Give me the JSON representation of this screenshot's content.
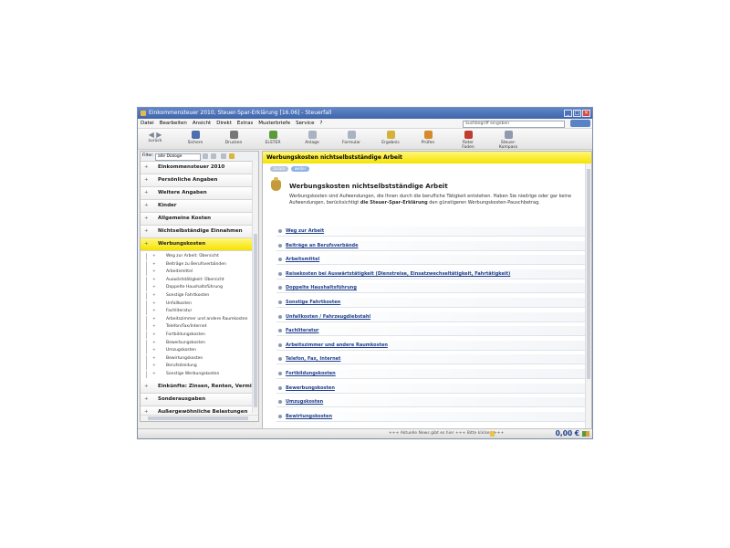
{
  "window": {
    "title": "Einkommensteuer 2010, Steuer-Spar-Erklärung [16.06] - Steuerfall"
  },
  "menu": [
    "Datei",
    "Bearbeiten",
    "Ansicht",
    "Direkt",
    "Extras",
    "Musterbriefe",
    "Service",
    "?"
  ],
  "search": {
    "placeholder": "Suchbegriff eingeben"
  },
  "toolbar": {
    "back_forward": "zurück",
    "buttons": [
      {
        "label": "Sichern",
        "icon": "save-icon",
        "color": "#4d6fae"
      },
      {
        "label": "Drucken",
        "icon": "print-icon",
        "color": "#777777"
      },
      {
        "label": "ELSTER",
        "icon": "elster-icon",
        "color": "#5a9a3a"
      },
      {
        "label": "Anlage",
        "icon": "attachment-icon",
        "color": "#a8b3c4"
      },
      {
        "label": "Formular",
        "icon": "form-icon",
        "color": "#a8b3c4"
      },
      {
        "label": "Ergebnis",
        "icon": "result-icon",
        "color": "#d6b13a"
      },
      {
        "label": "Prüfen",
        "icon": "check-icon",
        "color": "#d68a2a"
      },
      {
        "label": "Roter Faden",
        "icon": "red-thread-icon",
        "color": "#c33b2d"
      },
      {
        "label": "Steuer-Kompass",
        "icon": "compass-icon",
        "color": "#8e9ab0"
      }
    ]
  },
  "filter": {
    "label": "Filter:",
    "value": "alle Dialoge"
  },
  "sidebar": {
    "sections_top": [
      {
        "label": "Einkommensteuer 2010"
      },
      {
        "label": "Persönliche Angaben"
      },
      {
        "label": "Weitere Angaben"
      },
      {
        "label": "Kinder"
      },
      {
        "label": "Allgemeine Kosten"
      },
      {
        "label": "Nichtselbständige Einnahmen"
      },
      {
        "label": "Werbungskosten",
        "active": true
      }
    ],
    "tree_items": [
      "Weg zur Arbeit: Übersicht",
      "Beiträge zu Berufsverbänden",
      "Arbeitsmittel",
      "Auswärtstätigkeit: Übersicht",
      "Doppelte Haushaltsführung",
      "Sonstige Fahrtkosten",
      "Unfallkosten",
      "Fachliteratur",
      "Arbeitszimmer und andere Raumkosten",
      "Telefon/Fax/Internet",
      "Fortbildungskosten",
      "Bewerbungskosten",
      "Umzugskosten",
      "Bewirtungskosten",
      "Berufskleidung",
      "Sonstige Werbungskosten"
    ],
    "sections_bottom": [
      {
        "label": "Einkünfte: Zinsen, Renten, Vermietung"
      },
      {
        "label": "Sonderausgaben"
      },
      {
        "label": "Außergewöhnliche Belastungen"
      }
    ]
  },
  "content": {
    "header": "Werbungskosten nichtselbstständige Arbeit",
    "nav": {
      "back": "zurück",
      "forward": "weiter"
    },
    "title": "Werbungskosten nichtselbstständige Arbeit",
    "description_pre": "Werbungskosten sind Aufwendungen, die Ihnen durch die berufliche Tätigkeit entstehen. Haben Sie niedrige oder gar keine Aufwendungen, berücksichtigt ",
    "description_bold": "die Steuer-Spar-Erklärung",
    "description_post": " den günstigeren Werbungskosten-Pauschbetrag.",
    "links": [
      "Weg zur Arbeit",
      "Beiträge an Berufsverbände",
      "Arbeitsmittel",
      "Reisekosten bei Auswärtstätigkeit (Dienstreise, Einsatzwechseltätigkeit, Fahrtätigkeit)",
      "Doppelte Haushaltsführung",
      "Sonstige Fahrtkosten",
      "Unfallkosten / Fahrzeugdiebstahl",
      "Fachliteratur",
      "Arbeitszimmer und andere Raumkosten",
      "Telefon, Fax, Internet",
      "Fortbildungskosten",
      "Bewerbungskosten",
      "Umzugskosten",
      "Bewirtungskosten"
    ]
  },
  "status": {
    "text": "+++ Aktuelle News gibt es hier +++ Bitte klicken +++",
    "amount": "0,00 €"
  }
}
